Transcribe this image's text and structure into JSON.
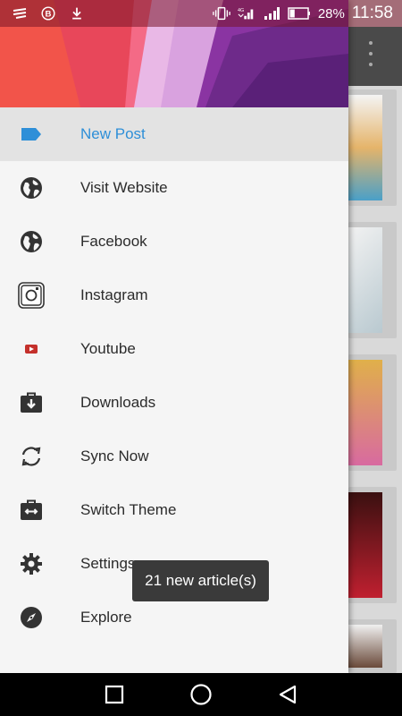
{
  "status_bar": {
    "battery": "28%",
    "time": "11:58",
    "signal_tag": "4G"
  },
  "drawer": {
    "items": [
      {
        "label": "New Post",
        "icon": "label-tag-icon",
        "active": true
      },
      {
        "label": "Visit Website",
        "icon": "globe-icon"
      },
      {
        "label": "Facebook",
        "icon": "globe-icon"
      },
      {
        "label": "Instagram",
        "icon": "instagram-icon"
      },
      {
        "label": "Youtube",
        "icon": "youtube-icon"
      },
      {
        "label": "Downloads",
        "icon": "downloads-briefcase-icon"
      },
      {
        "label": "Sync Now",
        "icon": "sync-icon"
      },
      {
        "label": "Switch Theme",
        "icon": "switch-theme-icon"
      },
      {
        "label": "Settings",
        "icon": "gear-icon"
      },
      {
        "label": "Explore",
        "icon": "compass-icon"
      }
    ]
  },
  "toast": {
    "text": "21 new article(s)"
  },
  "colors": {
    "accent": "#2e8fd8",
    "youtube": "#c4302b"
  }
}
